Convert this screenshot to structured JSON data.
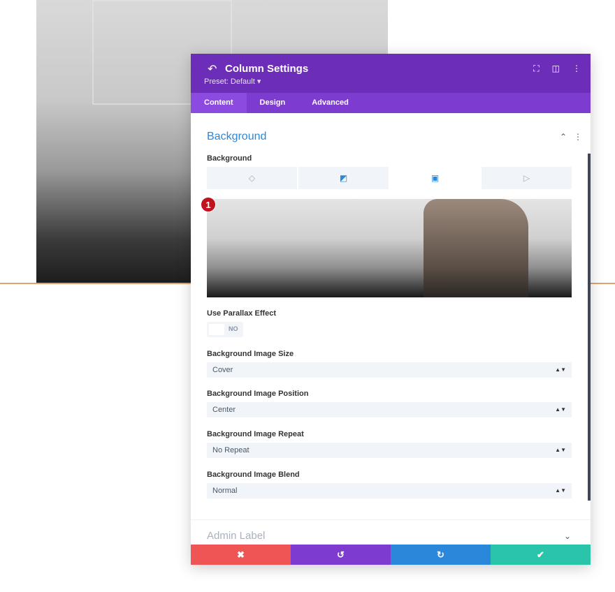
{
  "header": {
    "title": "Column Settings",
    "preset": "Preset: Default ▾"
  },
  "tabs": [
    {
      "label": "Content",
      "active": true
    },
    {
      "label": "Design"
    },
    {
      "label": "Advanced"
    }
  ],
  "section": {
    "title": "Background"
  },
  "background": {
    "label": "Background",
    "types": [
      "color",
      "gradient",
      "image",
      "video"
    ],
    "active_type": "image",
    "badge": "1"
  },
  "parallax": {
    "label": "Use Parallax Effect",
    "value": "NO"
  },
  "fields": [
    {
      "label": "Background Image Size",
      "value": "Cover"
    },
    {
      "label": "Background Image Position",
      "value": "Center"
    },
    {
      "label": "Background Image Repeat",
      "value": "No Repeat"
    },
    {
      "label": "Background Image Blend",
      "value": "Normal"
    }
  ],
  "admin": {
    "label": "Admin Label"
  },
  "footer": {
    "colors": {
      "cancel": "#ef5555",
      "undo": "#7e3bd0",
      "redo": "#2b87da",
      "save": "#29c4a9"
    }
  },
  "colors": {
    "header": "#6c2eb9",
    "tabs": "#7e3bd0",
    "accent": "#2b87da"
  }
}
